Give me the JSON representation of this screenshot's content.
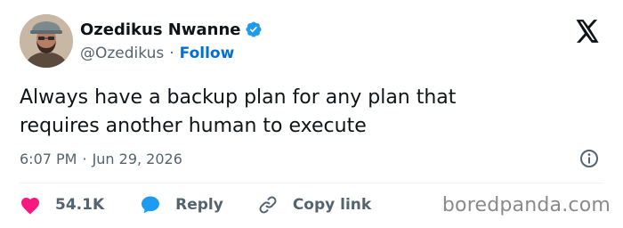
{
  "author": {
    "display_name": "Ozedikus Nwanne",
    "handle": "@Ozedikus",
    "separator": "·",
    "follow_label": "Follow",
    "verified": true
  },
  "tweet": {
    "text_line1": "Always have a backup plan for any plan that",
    "text_line2": "requires another human to execute",
    "time": "6:07 PM",
    "separator": "·",
    "date": "Jun 29, 2026"
  },
  "actions": {
    "like_count": "54.1K",
    "reply_label": "Reply",
    "copy_link_label": "Copy link"
  },
  "watermark": "boredpanda.com",
  "icons": {
    "platform": "x-logo-icon",
    "verified": "verified-badge-icon",
    "info": "info-icon",
    "like": "heart-icon",
    "reply": "speech-bubble-icon",
    "copy": "link-icon"
  },
  "colors": {
    "text": "#0f1419",
    "secondary": "#536471",
    "accent": "#006fd6",
    "verified": "#1d9bf0",
    "like": "#f91880",
    "reply": "#1d9bf0",
    "watermark": "#8a8a8a"
  }
}
